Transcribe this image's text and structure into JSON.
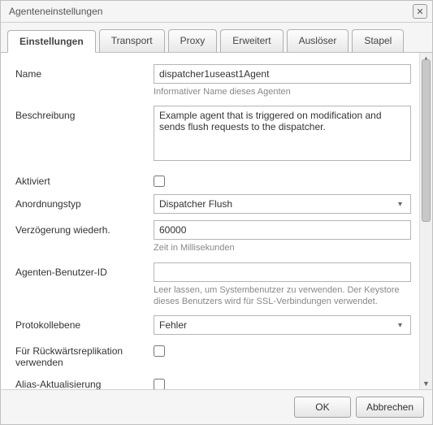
{
  "dialog_title": "Agenteneinstellungen",
  "tabs": {
    "settings": "Einstellungen",
    "transport": "Transport",
    "proxy": "Proxy",
    "extended": "Erweitert",
    "trigger": "Auslöser",
    "batch": "Stapel"
  },
  "labels": {
    "name": "Name",
    "description": "Beschreibung",
    "enabled": "Aktiviert",
    "serialization_type": "Anordnungstyp",
    "retry_delay": "Verzögerung wiederh.",
    "agent_user_id": "Agenten-Benutzer-ID",
    "log_level": "Protokollebene",
    "reverse_replication": "Für Rückwärtsreplikation verwenden",
    "alias_update": "Alias-Aktualisierung"
  },
  "values": {
    "name": "dispatcher1useast1Agent",
    "description": "Example agent that is triggered on modification and sends flush requests to the dispatcher.",
    "enabled": false,
    "serialization_type": "Dispatcher Flush",
    "retry_delay": "60000",
    "agent_user_id": "",
    "log_level": "Fehler",
    "reverse_replication": false,
    "alias_update": false
  },
  "hints": {
    "name": "Informativer Name dieses Agenten",
    "retry_delay": "Zeit in Millisekunden",
    "agent_user_id": "Leer lassen, um Systembenutzer zu verwenden. Der Keystore dieses Benutzers wird für SSL-Verbindungen verwendet."
  },
  "buttons": {
    "ok": "OK",
    "cancel": "Abbrechen"
  }
}
